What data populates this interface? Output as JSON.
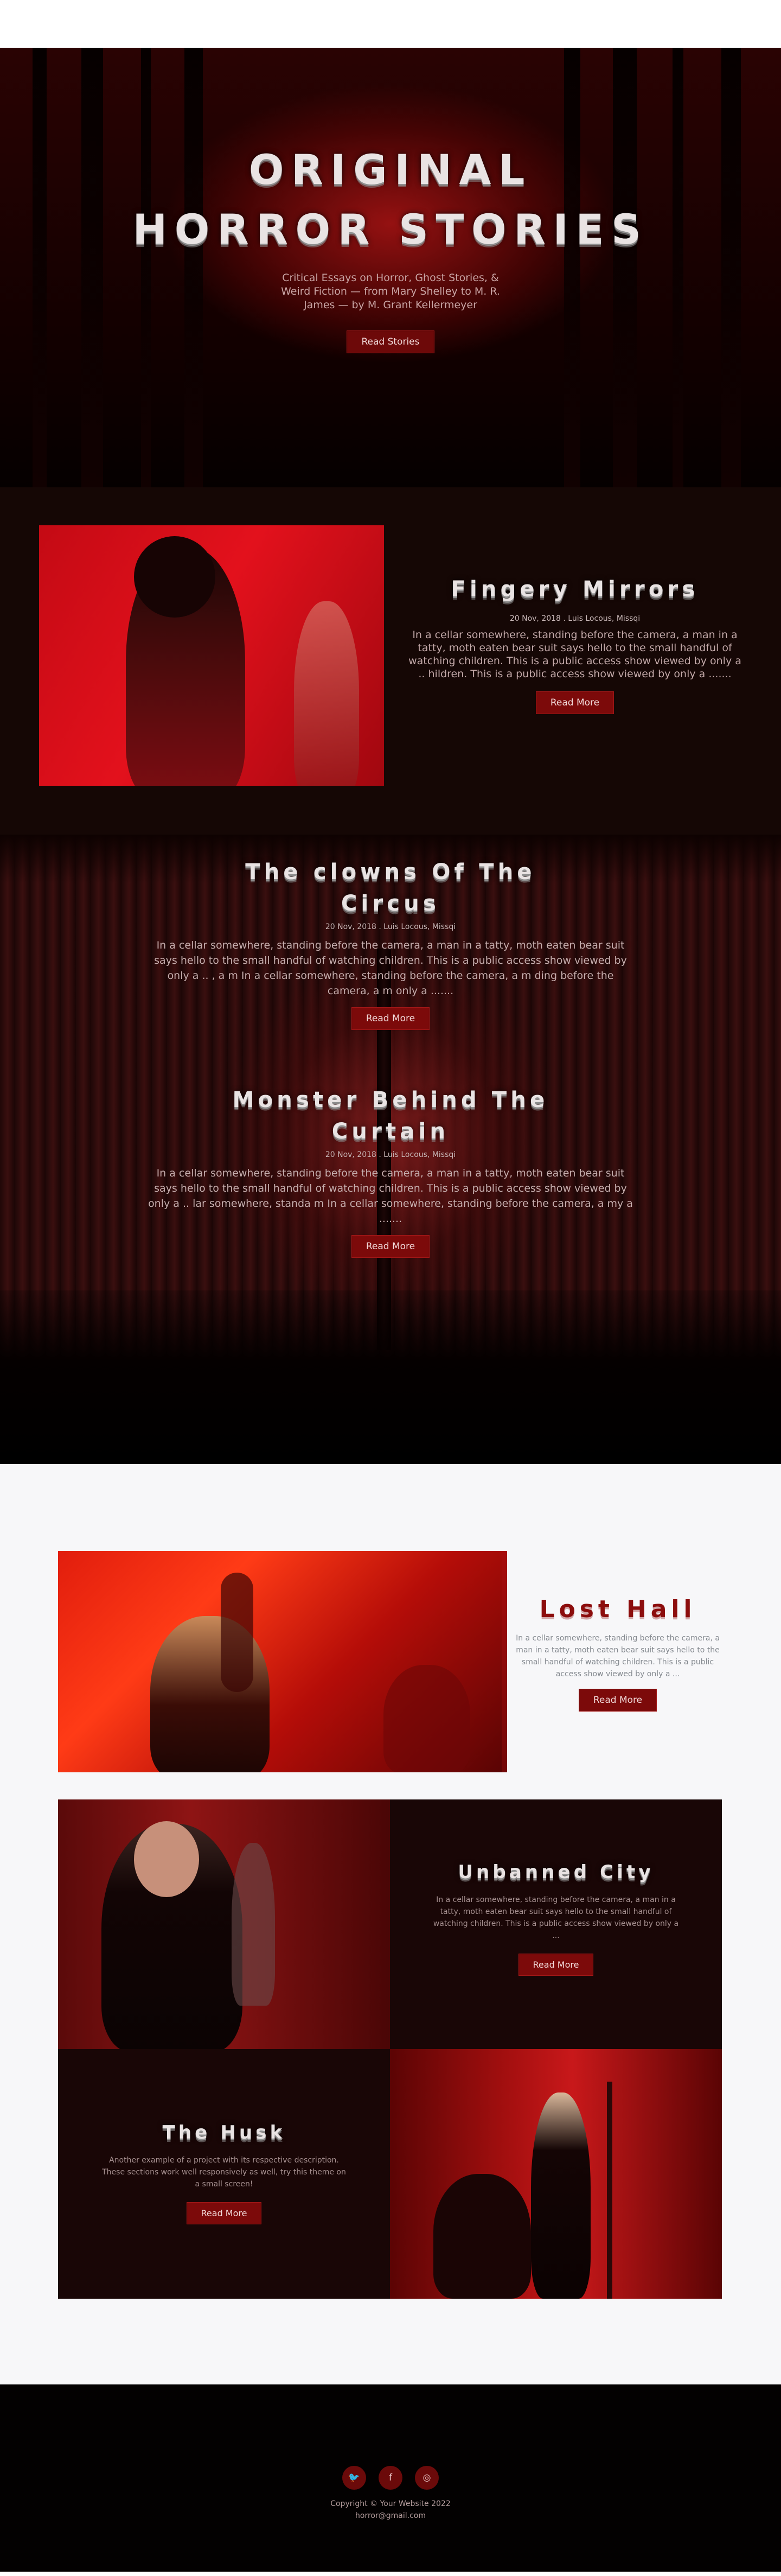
{
  "hero": {
    "title": "ORIGINAL HORROR STORIES",
    "subtitle": "Critical Essays on Horror, Ghost Stories, & Weird Fiction — from Mary Shelley to M. R. James — by M. Grant Kellermeyer",
    "cta": "Read Stories"
  },
  "featured": {
    "title": "Fingery Mirrors",
    "meta": "20 Nov, 2018 . Luis Locous, Missqi",
    "excerpt": "In a cellar somewhere, standing before the camera, a man in a tatty, moth eaten bear suit says hello to the small handful of watching children. This is a public access show viewed by only a .. hildren. This is a public access show viewed by only a .......",
    "cta": "Read More"
  },
  "curtain_posts": [
    {
      "title": "The clowns Of The Circus",
      "meta": "20 Nov, 2018 . Luis Locous, Missqi",
      "excerpt": "In a cellar somewhere, standing before the camera, a man in a tatty, moth eaten bear suit says hello to the small handful of watching children. This is a public access show viewed by only a .. , a m In a cellar somewhere, standing before the camera, a m ding before the camera, a m only a .......",
      "cta": "Read More"
    },
    {
      "title": "Monster Behind The Curtain",
      "meta": "20 Nov, 2018 . Luis Locous, Missqi",
      "excerpt": "In a cellar somewhere, standing before the camera, a man in a tatty, moth eaten bear suit says hello to the small handful of watching children. This is a public access show viewed by only a .. lar somewhere, standa m In a cellar somewhere, standing before the camera, a my a .......",
      "cta": "Read More"
    }
  ],
  "lost_hall": {
    "title": "Lost Hall",
    "excerpt": "In a cellar somewhere, standing before the camera, a man in a tatty, moth eaten bear suit says hello to the small handful of watching children. This is a public access show viewed by only a ...",
    "cta": "Read More"
  },
  "unbanned": {
    "title": "Unbanned City",
    "excerpt": "In a cellar somewhere, standing before the camera, a man in a tatty, moth eaten bear suit says hello to the small handful of watching children. This is a public access show viewed by only a ...",
    "cta": "Read More"
  },
  "husk": {
    "title": "The Husk",
    "excerpt": "Another example of a project with its respective description. These sections work well responsively as well, try this theme on a small screen!",
    "cta": "Read More"
  },
  "footer": {
    "social": [
      {
        "icon": "twitter-icon",
        "glyph": "🐦"
      },
      {
        "icon": "facebook-icon",
        "glyph": "f"
      },
      {
        "icon": "github-icon",
        "glyph": "◎"
      }
    ],
    "copyright": "Copyright © Your Website 2022",
    "email": "horror@gmail.com"
  }
}
